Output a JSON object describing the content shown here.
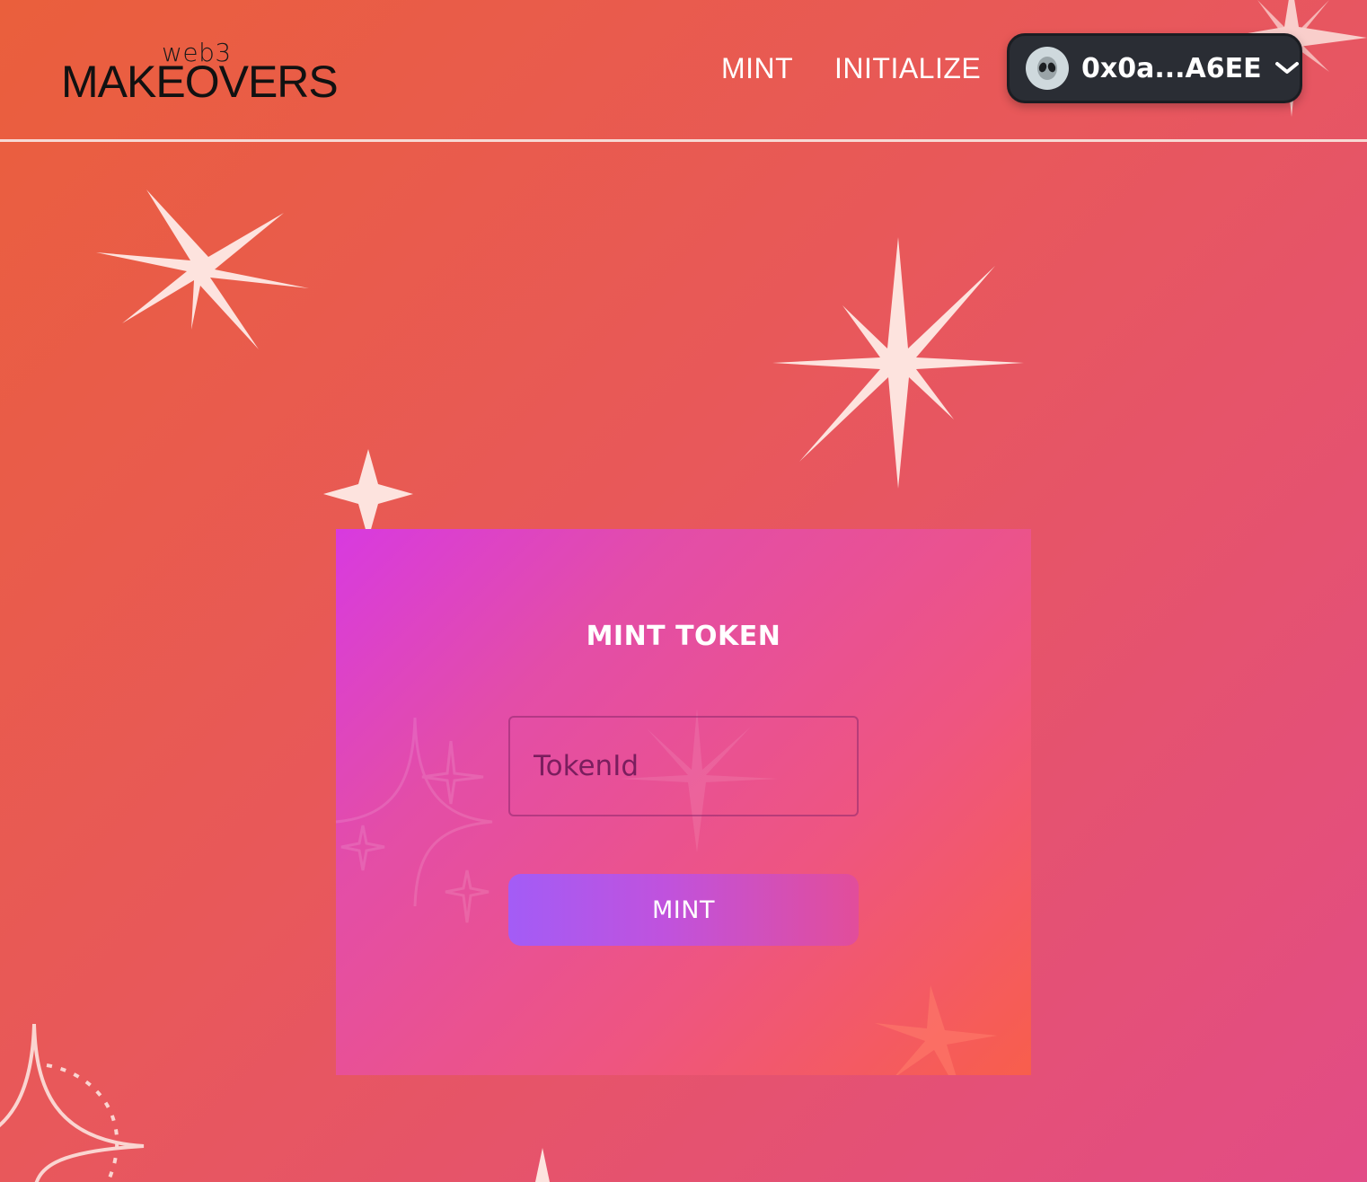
{
  "header": {
    "logo": {
      "small_text": "web3",
      "main_text": "MAKEOVERS"
    },
    "nav": {
      "mint_label": "MINT",
      "initialize_label": "INITIALIZE"
    },
    "wallet": {
      "avatar_icon": "alien-icon",
      "address": "0x0a...A6EE",
      "dropdown_icon": "chevron-down-icon"
    }
  },
  "card": {
    "title": "MINT TOKEN",
    "token_input": {
      "placeholder": "TokenId",
      "value": ""
    },
    "mint_button_label": "MINT"
  },
  "colors": {
    "background_start": "#ea5f3c",
    "background_end": "#e24c86",
    "card_start": "#d83ae0",
    "card_end": "#f85e4c",
    "button_start": "#a35cf6",
    "button_end": "#e24d9a",
    "wallet_bg": "#2a2d34",
    "sparkle": "#fde3de"
  }
}
